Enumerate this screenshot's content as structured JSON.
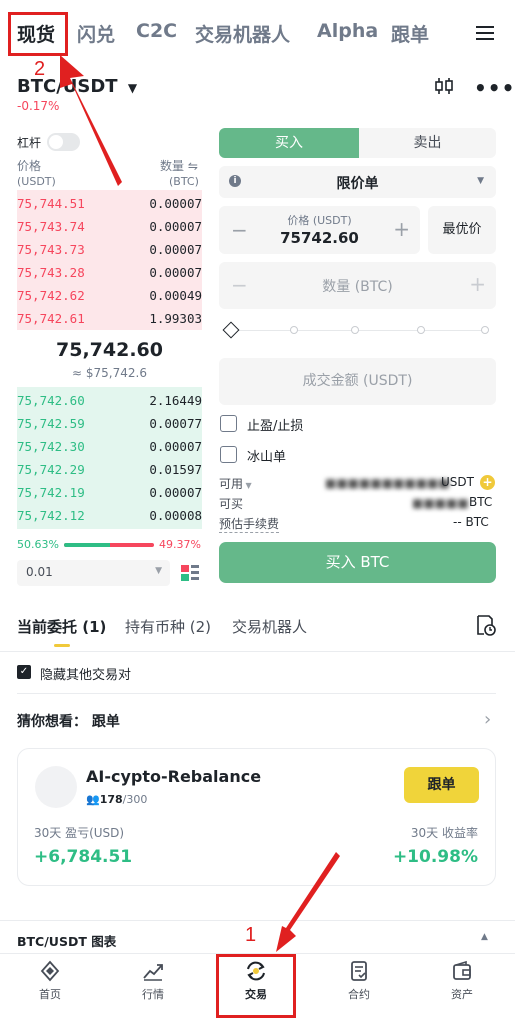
{
  "nav": {
    "tabs": [
      "现货",
      "闪兑",
      "C2C",
      "交易机器人",
      "Alpha",
      "跟单"
    ],
    "active_tab": "现货"
  },
  "annotations": {
    "label_1": "1",
    "label_2": "2"
  },
  "pair": {
    "symbol": "BTC/USDT",
    "change": "-0.17%"
  },
  "leverage": {
    "label": "杠杆"
  },
  "orderbook": {
    "price_header": "价格",
    "price_unit": "(USDT)",
    "qty_header": "数量",
    "qty_unit": "(BTC)",
    "asks": [
      {
        "price": "75,744.51",
        "qty": "0.00007"
      },
      {
        "price": "75,743.74",
        "qty": "0.00007"
      },
      {
        "price": "75,743.73",
        "qty": "0.00007"
      },
      {
        "price": "75,743.28",
        "qty": "0.00007"
      },
      {
        "price": "75,742.62",
        "qty": "0.00049"
      },
      {
        "price": "75,742.61",
        "qty": "1.99303"
      }
    ],
    "last_price": "75,742.60",
    "last_price_fiat": "≈ $75,742.6",
    "bids": [
      {
        "price": "75,742.60",
        "qty": "2.16449"
      },
      {
        "price": "75,742.59",
        "qty": "0.00077"
      },
      {
        "price": "75,742.30",
        "qty": "0.00007"
      },
      {
        "price": "75,742.29",
        "qty": "0.01597"
      },
      {
        "price": "75,742.19",
        "qty": "0.00007"
      },
      {
        "price": "75,742.12",
        "qty": "0.00008"
      }
    ],
    "buy_ratio": "50.63%",
    "sell_ratio": "49.37%",
    "buy_fraction": 0.5063,
    "depth": "0.01"
  },
  "form": {
    "buy_tab": "买入",
    "sell_tab": "卖出",
    "order_type": "限价单",
    "price_label": "价格 (USDT)",
    "price_value": "75742.60",
    "best_price": "最优价",
    "qty_placeholder": "数量 (BTC)",
    "amount_placeholder": "成交金额 (USDT)",
    "tp_sl": "止盈/止损",
    "iceberg": "冰山单",
    "available_label": "可用",
    "available_unit": "USDT",
    "can_buy_label": "可买",
    "can_buy_unit": "BTC",
    "fee_label": "预估手续费",
    "fee_value": "-- BTC",
    "submit": "买入 BTC"
  },
  "lower_tabs": {
    "tabs": [
      "当前委托 (1)",
      "持有币种 (2)",
      "交易机器人"
    ],
    "hide_pairs": "隐藏其他交易对"
  },
  "suggest": {
    "title": "猜你想看：  跟单",
    "card": {
      "name": "AI-cypto-Rebalance",
      "followers": "178",
      "followers_max": "/300",
      "follow_button": "跟单",
      "pnl_label": "30天 盈亏(USD)",
      "pnl_value": "+6,784.51",
      "roi_label": "30天 收益率",
      "roi_value": "+10.98%"
    }
  },
  "chart_bar": {
    "label": "BTC/USDT 图表"
  },
  "bottom_nav": {
    "items": [
      "首页",
      "行情",
      "交易",
      "合约",
      "资产"
    ],
    "active": "交易"
  },
  "colors": {
    "green": "#2ebd85",
    "red": "#f6465d",
    "button_green": "#65b88a",
    "yellow": "#f0d43a",
    "annotation": "#e02020"
  }
}
